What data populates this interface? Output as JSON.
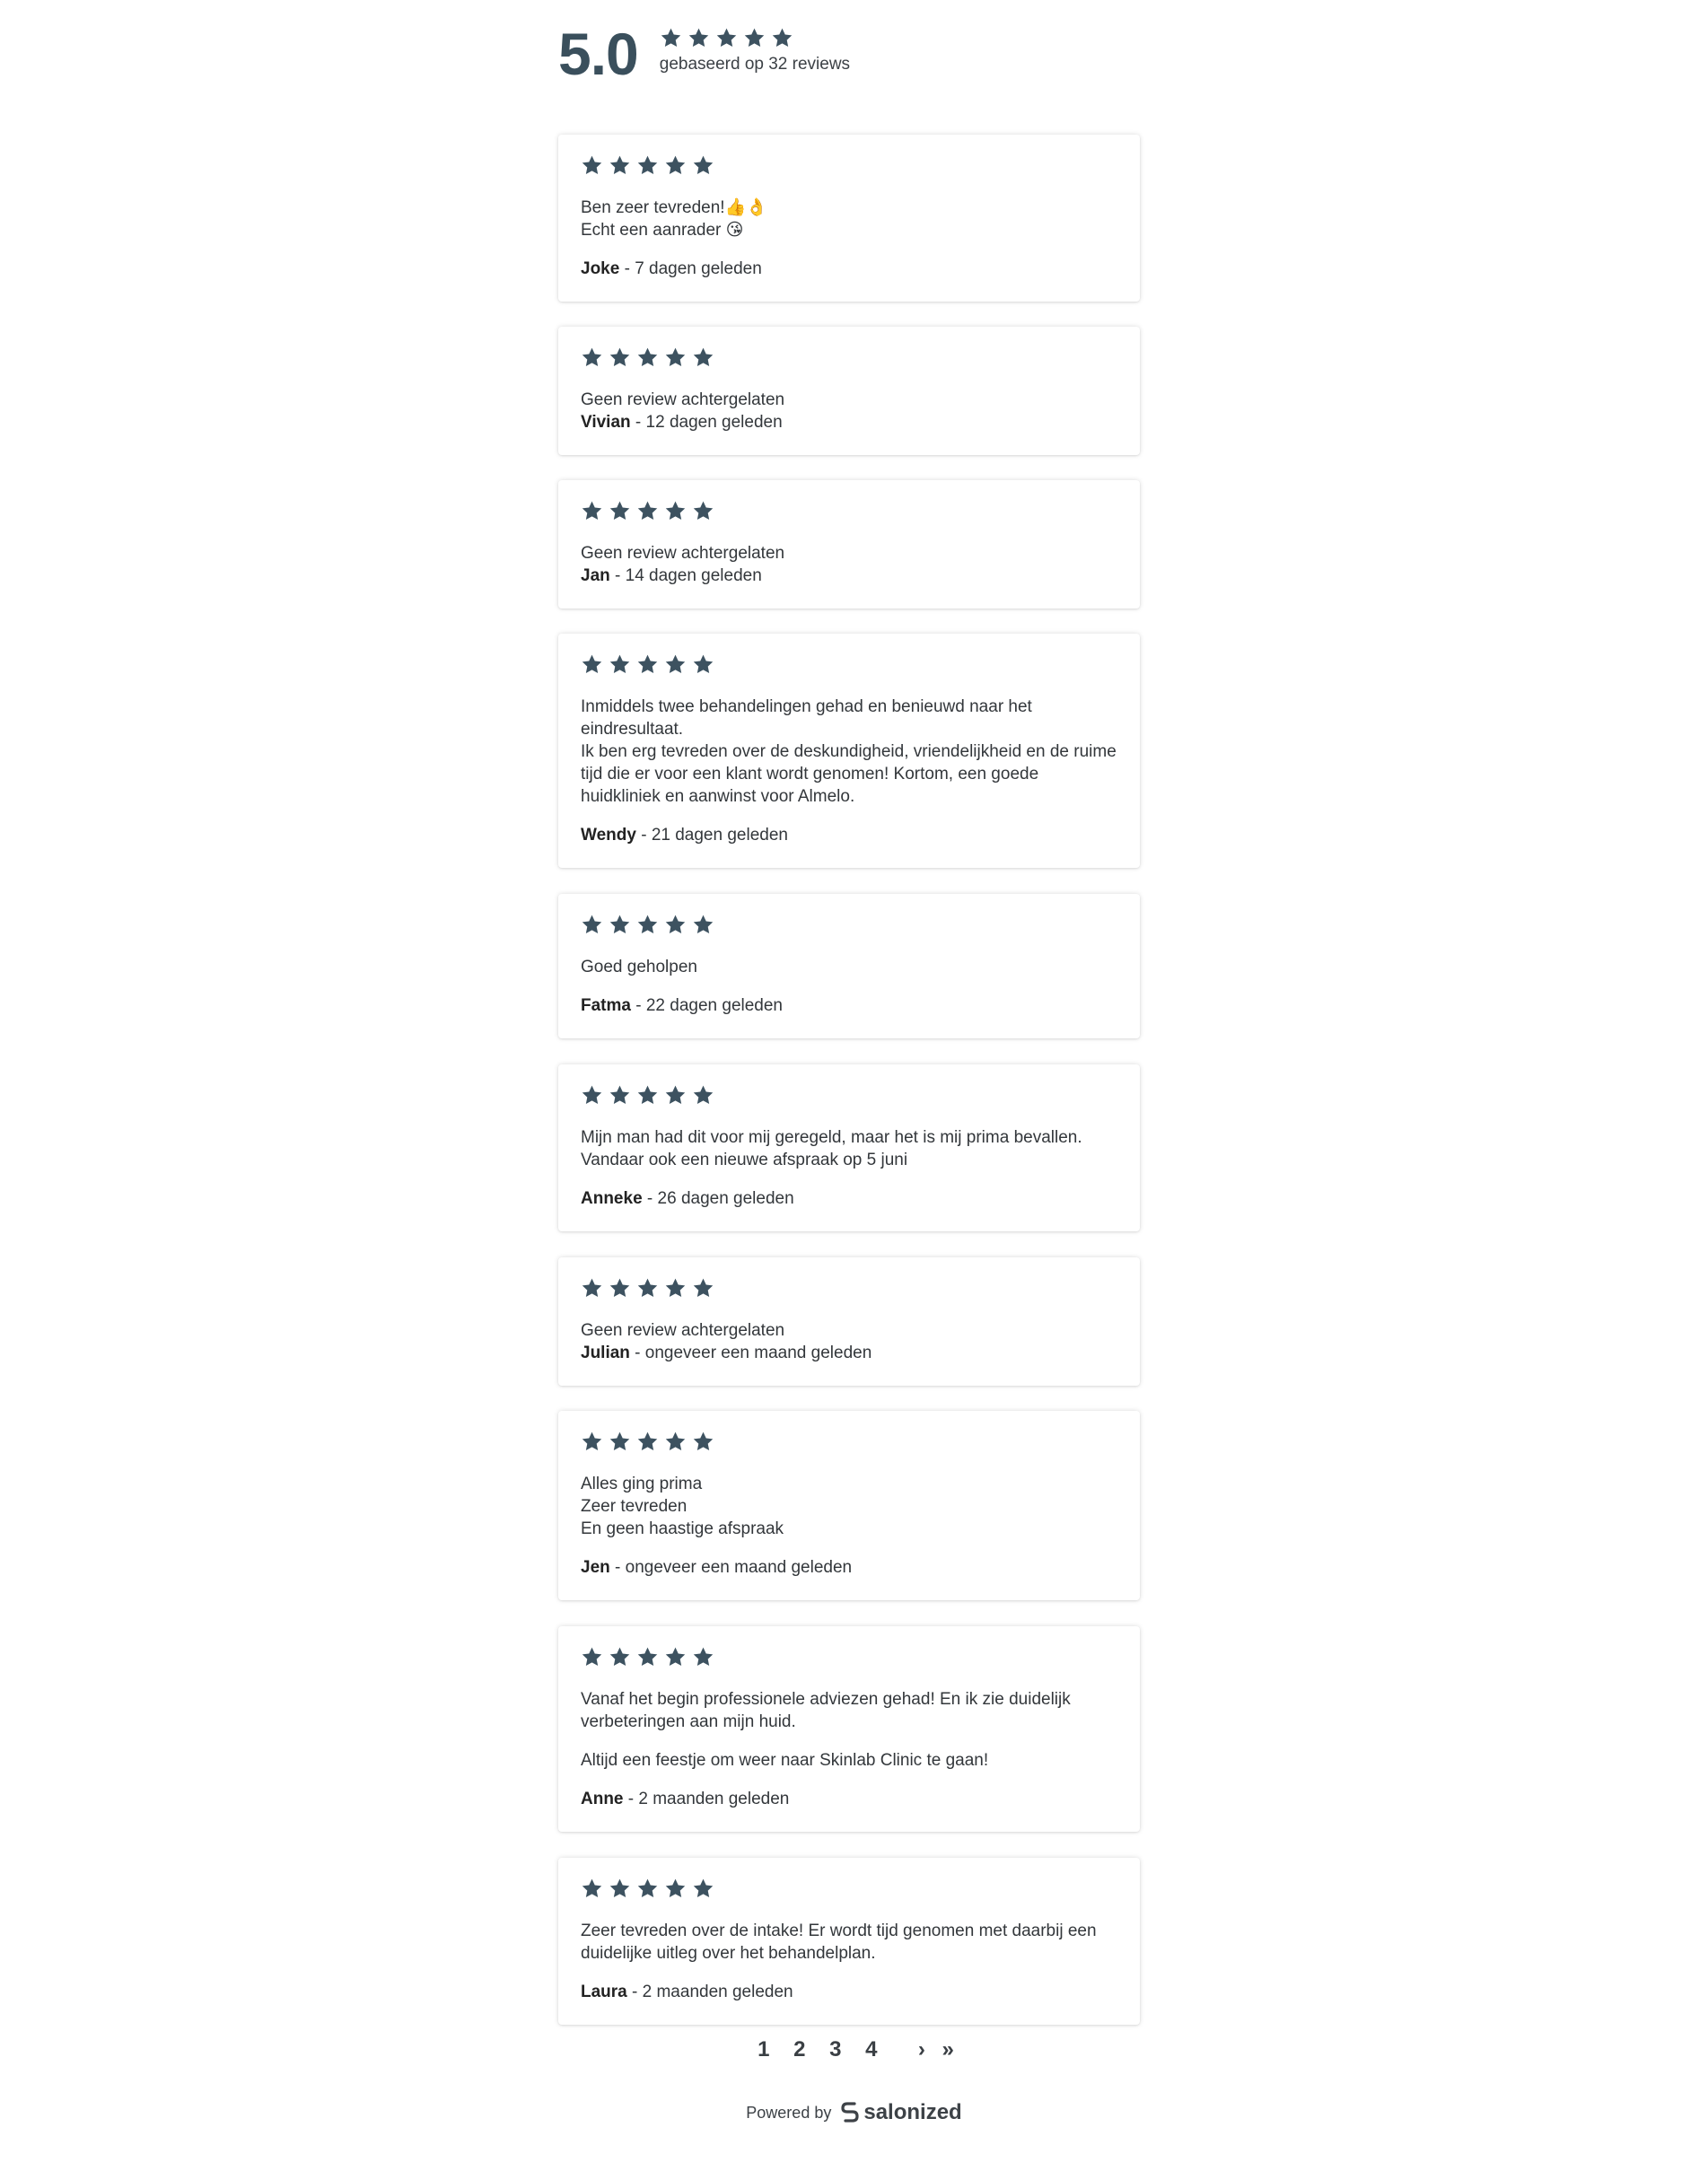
{
  "summary": {
    "score": "5.0",
    "stars": 5,
    "count_text": "gebaseerd op 32 reviews"
  },
  "reviews": [
    {
      "stars": 5,
      "text": [
        "Ben zeer tevreden!👍👌",
        "Echt een aanrader 😘"
      ],
      "author": "Joke",
      "when": " - 7 dagen geleden"
    },
    {
      "stars": 5,
      "text": [
        "Geen review achtergelaten"
      ],
      "author": "Vivian",
      "when": " - 12 dagen geleden"
    },
    {
      "stars": 5,
      "text": [
        "Geen review achtergelaten"
      ],
      "author": "Jan",
      "when": " - 14 dagen geleden"
    },
    {
      "stars": 5,
      "text": [
        "Inmiddels twee behandelingen gehad en benieuwd naar het eindresultaat.",
        "Ik ben erg tevreden over de deskundigheid, vriendelijkheid en de ruime tijd die er voor een klant wordt genomen! Kortom, een goede huidkliniek en aanwinst voor Almelo."
      ],
      "author": "Wendy",
      "when": " - 21 dagen geleden"
    },
    {
      "stars": 5,
      "text": [
        "Goed geholpen"
      ],
      "author": "Fatma",
      "when": " - 22 dagen geleden"
    },
    {
      "stars": 5,
      "text": [
        "Mijn man had dit voor mij geregeld, maar het is mij prima bevallen.",
        "Vandaar ook een nieuwe afspraak op 5 juni"
      ],
      "author": "Anneke",
      "when": " - 26 dagen geleden"
    },
    {
      "stars": 5,
      "text": [
        "Geen review achtergelaten"
      ],
      "author": "Julian",
      "when": " - ongeveer een maand geleden"
    },
    {
      "stars": 5,
      "text": [
        "Alles ging prima",
        "Zeer tevreden",
        "En geen haastige afspraak"
      ],
      "author": "Jen",
      "when": " - ongeveer een maand geleden"
    },
    {
      "stars": 5,
      "text": [
        "Vanaf het begin professionele adviezen gehad! En ik zie duidelijk verbeteringen aan mijn huid.",
        "Altijd een feestje om weer naar Skinlab Clinic te gaan!"
      ],
      "author": "Anne",
      "when": " - 2 maanden geleden"
    },
    {
      "stars": 5,
      "text": [
        "Zeer tevreden over de intake! Er wordt tijd genomen met daarbij een duidelijke uitleg over het behandelplan."
      ],
      "author": "Laura",
      "when": " - 2 maanden geleden"
    }
  ],
  "pagination": {
    "pages": [
      "1",
      "2",
      "3",
      "4"
    ],
    "next": "›",
    "last": "»"
  },
  "footer": {
    "powered_by": "Powered by",
    "brand": "salonized",
    "brand_icon": "salonized-logo-icon"
  },
  "colors": {
    "star": "#3d5260",
    "score": "#3a4f5c"
  }
}
